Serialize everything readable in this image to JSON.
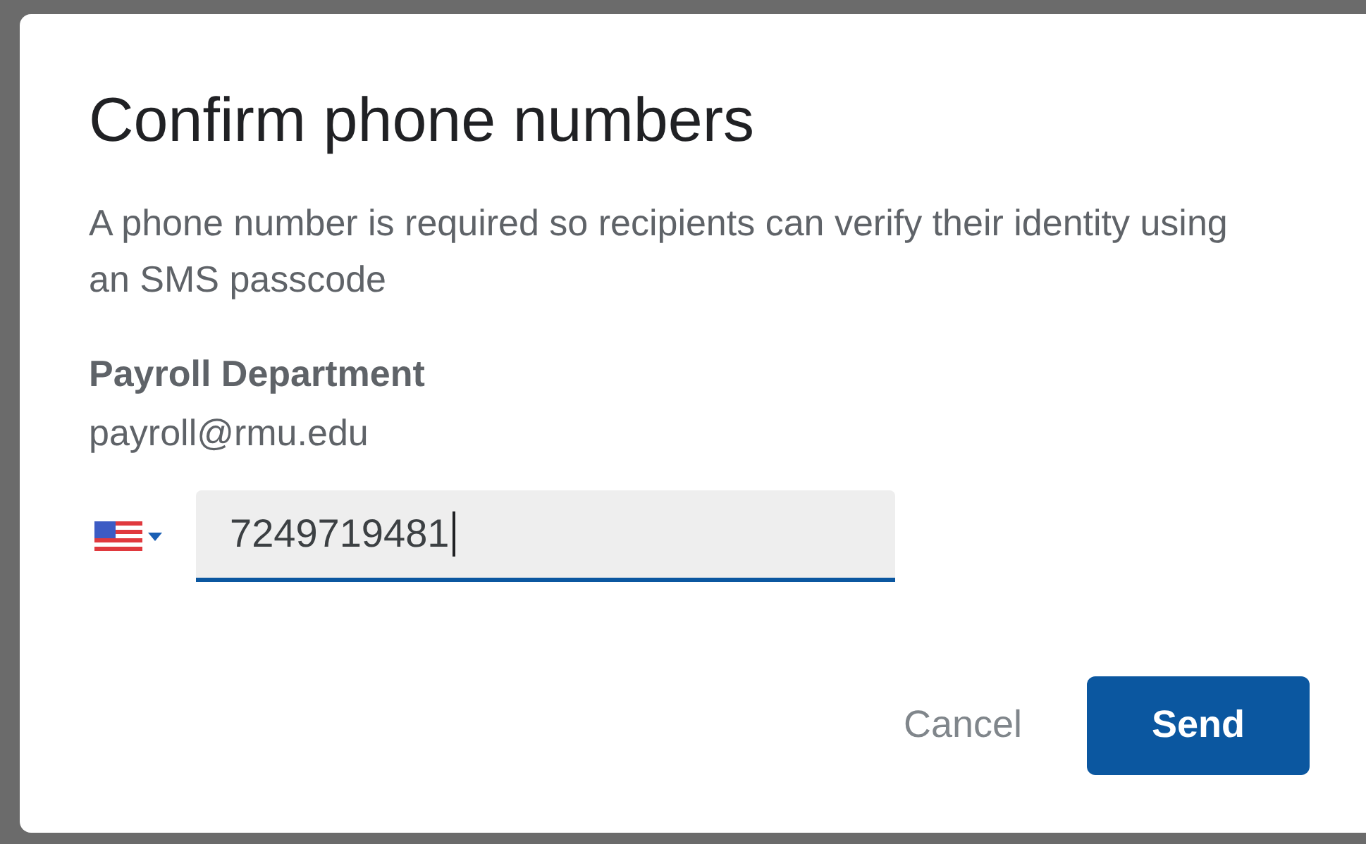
{
  "dialog": {
    "title": "Confirm phone numbers",
    "description": "A phone number is required so recipients can verify their identity using an SMS passcode",
    "recipient": {
      "name": "Payroll Department",
      "email": "payroll@rmu.edu"
    },
    "phone": {
      "value": "7249719481",
      "focused": true
    },
    "buttons": [
      {
        "label": "Cancel",
        "kind": "text"
      },
      {
        "label": "Send",
        "kind": "primary"
      }
    ]
  }
}
